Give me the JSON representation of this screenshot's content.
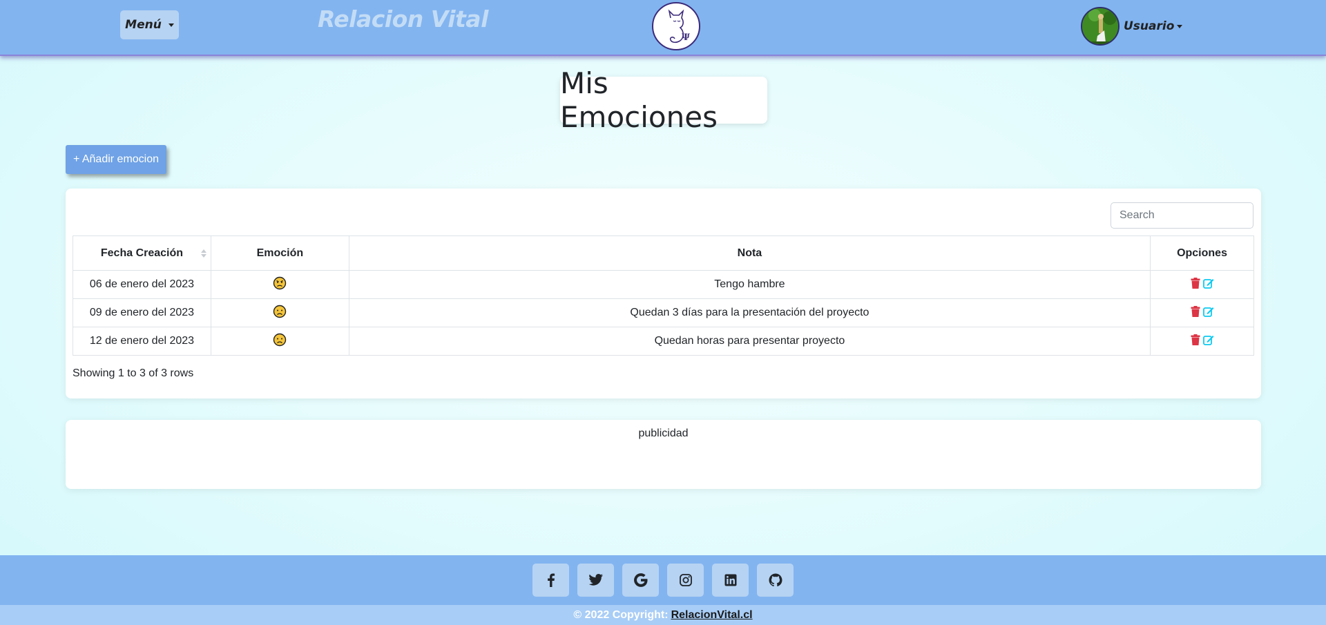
{
  "navbar": {
    "menu_label": "Menú",
    "brand": "Relacion Vital",
    "logo_icon": "cat-psi-logo-icon",
    "user_label": "Usuario",
    "bg_color": "#82b4f0"
  },
  "page": {
    "title": "Mis Emociones",
    "add_button": "+ Añadir emocion"
  },
  "table": {
    "search_placeholder": "Search",
    "headers": [
      "Fecha Creación",
      "Emoción",
      "Nota",
      "Opciones"
    ],
    "rows": [
      {
        "fecha": "06 de enero del 2023",
        "emocion": "angry-face",
        "nota": "Tengo hambre"
      },
      {
        "fecha": "09 de enero del 2023",
        "emocion": "frowning-face",
        "nota": "Quedan 3 días para la presentación del proyecto"
      },
      {
        "fecha": "12 de enero del 2023",
        "emocion": "frowning-face",
        "nota": "Quedan horas para presentar proyecto"
      }
    ],
    "pagination_info": "Showing 1 to 3 of 3 rows",
    "delete_color": "#dc3545",
    "edit_color": "#0dcaf0"
  },
  "ad": {
    "label": "publicidad"
  },
  "footer": {
    "social": [
      "facebook-icon",
      "twitter-icon",
      "google-icon",
      "instagram-icon",
      "linkedin-icon",
      "github-icon"
    ],
    "copyright": "© 2022 Copyright:",
    "link": "RelacionVital.cl"
  }
}
